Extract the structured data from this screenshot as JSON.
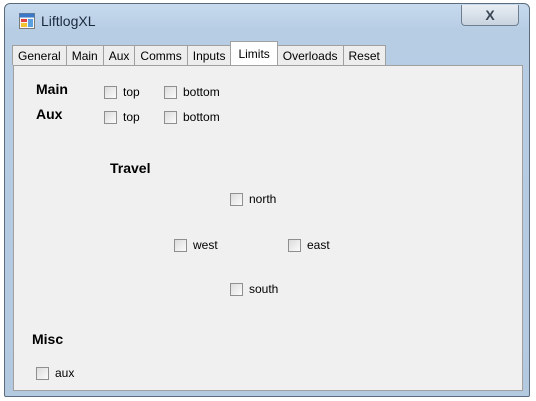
{
  "window": {
    "title": "LiftlogXL",
    "close_glyph": "X"
  },
  "tabs": [
    "General",
    "Main",
    "Aux",
    "Comms",
    "Inputs",
    "Limits",
    "Overloads",
    "Reset"
  ],
  "active_tab": "Limits",
  "limits": {
    "main_label": "Main",
    "aux_label": "Aux",
    "main_top": "top",
    "main_bottom": "bottom",
    "aux_top": "top",
    "aux_bottom": "bottom",
    "travel_label": "Travel",
    "north": "north",
    "west": "west",
    "east": "east",
    "south": "south",
    "misc_label": "Misc",
    "misc_aux": "aux"
  },
  "icons": {
    "app": "app-window-icon",
    "close": "close-icon"
  }
}
